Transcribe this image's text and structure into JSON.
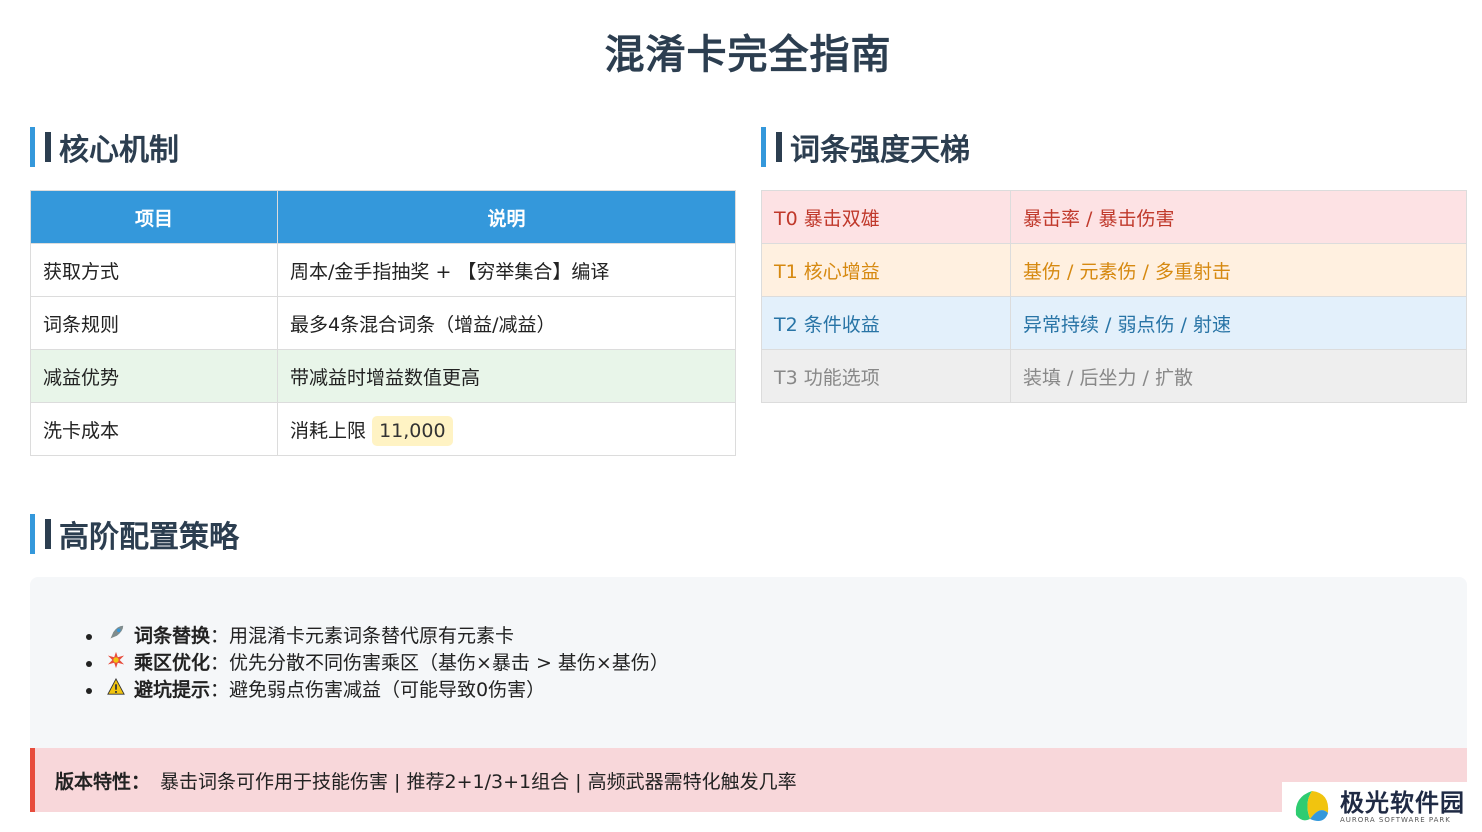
{
  "title": "混淆卡完全指南",
  "sections": {
    "core": "核心机制",
    "tier": "词条强度天梯",
    "strategy": "高阶配置策略"
  },
  "core_table": {
    "headers": [
      "项目",
      "说明"
    ],
    "rows": [
      {
        "item": "获取方式",
        "desc": "周本/金手指抽奖 + 【穷举集合】编译"
      },
      {
        "item": "词条规则",
        "desc": "最多4条混合词条（增益/减益）"
      },
      {
        "item": "减益优势",
        "desc": "带减益时增益数值更高"
      },
      {
        "item": "洗卡成本",
        "desc": "消耗上限",
        "badge": "11,000"
      }
    ]
  },
  "tier_table": [
    {
      "tier": "T0 暴击双雄",
      "stats": "暴击率 / 暴击伤害",
      "color": "#c0392b"
    },
    {
      "tier": "T1 核心增益",
      "stats": "基伤 / 元素伤 / 多重射击",
      "color": "#d68910"
    },
    {
      "tier": "T2 条件收益",
      "stats": "异常持续 / 弱点伤 / 射速",
      "color": "#2874a6"
    },
    {
      "tier": "T3 功能选项",
      "stats": "装填 / 后坐力 / 扩散",
      "color": "#888888"
    }
  ],
  "strategy_items": [
    {
      "icon": "rocket-icon",
      "label": "词条替换",
      "text": "：用混淆卡元素词条替代原有元素卡"
    },
    {
      "icon": "collision-icon",
      "label": "乘区优化",
      "text": "：优先分散不同伤害乘区（基伤×暴击 > 基伤×基伤）"
    },
    {
      "icon": "warning-icon",
      "label": "避坑提示",
      "text": "：避免弱点伤害减益（可能导致0伤害）"
    }
  ],
  "note": {
    "label": "版本特性：",
    "text": "暴击词条可作用于技能伤害 | 推荐2+1/3+1组合 | 高频武器需特化触发几率"
  },
  "logo": {
    "main": "极光软件园",
    "sub": "AURORA SOFTWARE PARK"
  }
}
